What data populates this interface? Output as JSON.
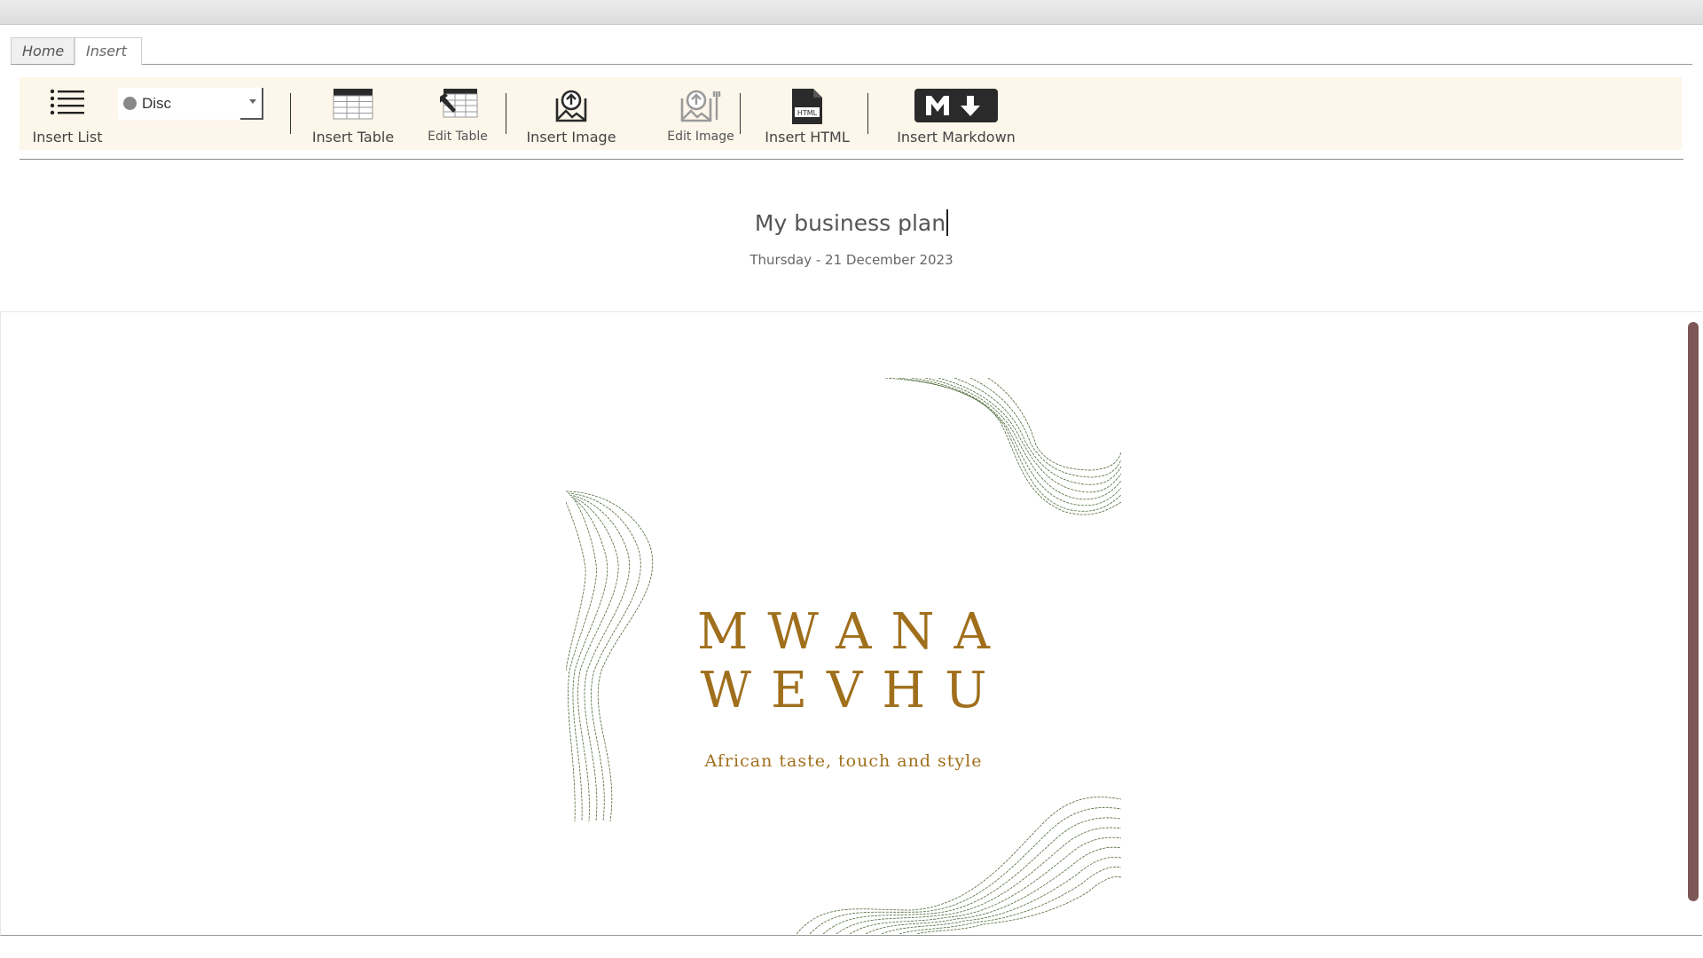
{
  "tabs": [
    {
      "label": "Home"
    },
    {
      "label": "Insert"
    }
  ],
  "ribbon": {
    "insert_list": "Insert List",
    "list_style": {
      "selected": "Disc"
    },
    "insert_table": "Insert Table",
    "edit_table": "Edit Table",
    "insert_image": "Insert Image",
    "edit_image": "Edit Image",
    "insert_html": "Insert HTML",
    "insert_markdown": "Insert Markdown"
  },
  "document": {
    "title": "My business plan",
    "date": "Thursday - 21 December 2023"
  },
  "cover": {
    "brand_line1": "MWANA",
    "brand_line2": "WEVHU",
    "tagline": "African taste, touch and style"
  },
  "colors": {
    "ribbon_bg": "#fdf6ea",
    "brand_gold": "#a06f1c",
    "line_green": "#4f6b3a",
    "scrollbar": "#7d5656"
  },
  "icons": {
    "html_badge": "HTML"
  }
}
